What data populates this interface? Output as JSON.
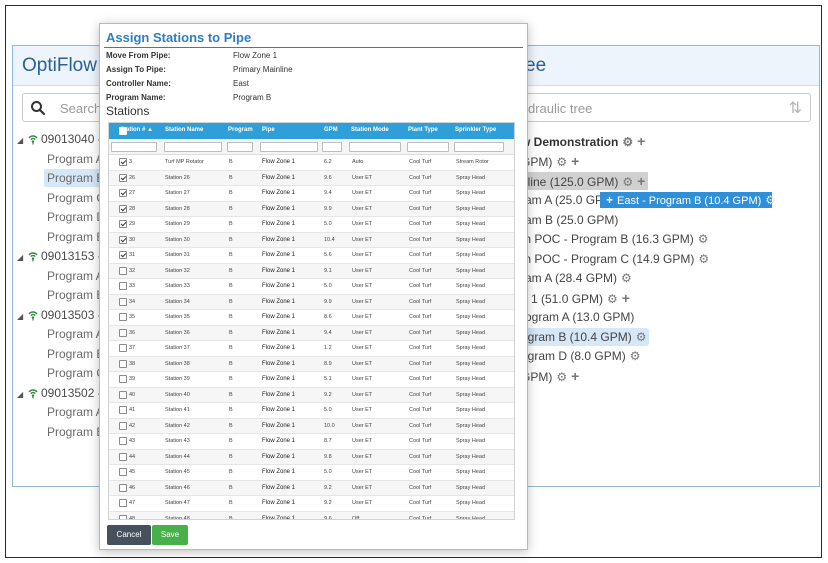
{
  "app": {
    "title_left": "OptiFlow C",
    "title_right": "ee",
    "search_placeholder": "Search",
    "tree_search_placeholder": "draulic tree"
  },
  "controllers": [
    {
      "id": "09013040 -",
      "programs": [
        "Program A",
        "Program B",
        "Program C",
        "Program D",
        "Program E"
      ]
    },
    {
      "id": "09013153 -",
      "programs": [
        "Program A",
        "Program B"
      ]
    },
    {
      "id": "09013503 -",
      "programs": [
        "Program A",
        "Program B",
        "Program C"
      ]
    },
    {
      "id": "09013502 -",
      "programs": [
        "Program A",
        "Program B"
      ]
    }
  ],
  "hydraulic_tree": [
    "w Demonstration",
    "GPM)",
    "nline (125.0 GPM)",
    "ram A (25.0 GP",
    "ram B (25.0 GPM)",
    "th POC - Program B (16.3 GPM)",
    "th POC - Program C (14.9 GPM)",
    "ram A (28.4 GPM)",
    "e 1 (51.0 GPM)",
    "rogram A (13.0 GPM)",
    "ogram B (10.4 GPM)",
    "ogram D (8.0 GPM)",
    "GPM)"
  ],
  "drag_tag": "East - Program B (10.4 GPM)",
  "modal": {
    "title": "Assign Stations to Pipe",
    "move_from_label": "Move From Pipe:",
    "move_from_value": "Flow Zone 1",
    "assign_to_label": "Assign To Pipe:",
    "assign_to_value": "Primary Mainline",
    "controller_label": "Controller Name:",
    "controller_value": "East",
    "program_label": "Program Name:",
    "program_value": "Program B",
    "stations_heading": "Stations",
    "cancel_label": "Cancel",
    "save_label": "Save",
    "columns": [
      "Station #",
      "Station Name",
      "Program",
      "Pipe",
      "GPM",
      "Station Mode",
      "Plant Type",
      "Sprinkler Type"
    ]
  },
  "stations": [
    {
      "checked": true,
      "num": "3",
      "name": "Turf MP Rotator",
      "program": "B",
      "pipe": "Flow Zone 1",
      "gpm": "6.2",
      "mode": "Auto",
      "plant": "Cool Turf",
      "sprinkler": "Stream Rotor"
    },
    {
      "checked": true,
      "num": "26",
      "name": "Station 26",
      "program": "B",
      "pipe": "Flow Zone 1",
      "gpm": "9.6",
      "mode": "User ET",
      "plant": "Cool Turf",
      "sprinkler": "Spray Head"
    },
    {
      "checked": true,
      "num": "27",
      "name": "Station 27",
      "program": "B",
      "pipe": "Flow Zone 1",
      "gpm": "9.4",
      "mode": "User ET",
      "plant": "Cool Turf",
      "sprinkler": "Spray Head"
    },
    {
      "checked": true,
      "num": "28",
      "name": "Station 28",
      "program": "B",
      "pipe": "Flow Zone 1",
      "gpm": "9.9",
      "mode": "User ET",
      "plant": "Cool Turf",
      "sprinkler": "Spray Head"
    },
    {
      "checked": true,
      "num": "29",
      "name": "Station 29",
      "program": "B",
      "pipe": "Flow Zone 1",
      "gpm": "5.0",
      "mode": "User ET",
      "plant": "Cool Turf",
      "sprinkler": "Spray Head"
    },
    {
      "checked": true,
      "num": "30",
      "name": "Station 30",
      "program": "B",
      "pipe": "Flow Zone 1",
      "gpm": "10.4",
      "mode": "User ET",
      "plant": "Cool Turf",
      "sprinkler": "Spray Head"
    },
    {
      "checked": true,
      "num": "31",
      "name": "Station 31",
      "program": "B",
      "pipe": "Flow Zone 1",
      "gpm": "5.6",
      "mode": "User ET",
      "plant": "Cool Turf",
      "sprinkler": "Spray Head"
    },
    {
      "checked": false,
      "num": "32",
      "name": "Station 32",
      "program": "B",
      "pipe": "Flow Zone 1",
      "gpm": "9.1",
      "mode": "User ET",
      "plant": "Cool Turf",
      "sprinkler": "Spray Head"
    },
    {
      "checked": false,
      "num": "33",
      "name": "Station 33",
      "program": "B",
      "pipe": "Flow Zone 1",
      "gpm": "5.0",
      "mode": "User ET",
      "plant": "Cool Turf",
      "sprinkler": "Spray Head"
    },
    {
      "checked": false,
      "num": "34",
      "name": "Station 34",
      "program": "B",
      "pipe": "Flow Zone 1",
      "gpm": "9.9",
      "mode": "User ET",
      "plant": "Cool Turf",
      "sprinkler": "Spray Head"
    },
    {
      "checked": false,
      "num": "35",
      "name": "Station 35",
      "program": "B",
      "pipe": "Flow Zone 1",
      "gpm": "8.6",
      "mode": "User ET",
      "plant": "Cool Turf",
      "sprinkler": "Spray Head"
    },
    {
      "checked": false,
      "num": "36",
      "name": "Station 36",
      "program": "B",
      "pipe": "Flow Zone 1",
      "gpm": "9.4",
      "mode": "User ET",
      "plant": "Cool Turf",
      "sprinkler": "Spray Head"
    },
    {
      "checked": false,
      "num": "37",
      "name": "Station 37",
      "program": "B",
      "pipe": "Flow Zone 1",
      "gpm": "1.2",
      "mode": "User ET",
      "plant": "Cool Turf",
      "sprinkler": "Spray Head"
    },
    {
      "checked": false,
      "num": "38",
      "name": "Station 38",
      "program": "B",
      "pipe": "Flow Zone 1",
      "gpm": "8.9",
      "mode": "User ET",
      "plant": "Cool Turf",
      "sprinkler": "Spray Head"
    },
    {
      "checked": false,
      "num": "39",
      "name": "Station 39",
      "program": "B",
      "pipe": "Flow Zone 1",
      "gpm": "5.1",
      "mode": "User ET",
      "plant": "Cool Turf",
      "sprinkler": "Spray Head"
    },
    {
      "checked": false,
      "num": "40",
      "name": "Station 40",
      "program": "B",
      "pipe": "Flow Zone 1",
      "gpm": "9.2",
      "mode": "User ET",
      "plant": "Cool Turf",
      "sprinkler": "Spray Head"
    },
    {
      "checked": false,
      "num": "41",
      "name": "Station 41",
      "program": "B",
      "pipe": "Flow Zone 1",
      "gpm": "5.0",
      "mode": "User ET",
      "plant": "Cool Turf",
      "sprinkler": "Spray Head"
    },
    {
      "checked": false,
      "num": "42",
      "name": "Station 42",
      "program": "B",
      "pipe": "Flow Zone 1",
      "gpm": "10.0",
      "mode": "User ET",
      "plant": "Cool Turf",
      "sprinkler": "Spray Head"
    },
    {
      "checked": false,
      "num": "43",
      "name": "Station 43",
      "program": "B",
      "pipe": "Flow Zone 1",
      "gpm": "8.7",
      "mode": "User ET",
      "plant": "Cool Turf",
      "sprinkler": "Spray Head"
    },
    {
      "checked": false,
      "num": "44",
      "name": "Station 44",
      "program": "B",
      "pipe": "Flow Zone 1",
      "gpm": "9.8",
      "mode": "User ET",
      "plant": "Cool Turf",
      "sprinkler": "Spray Head"
    },
    {
      "checked": false,
      "num": "45",
      "name": "Station 45",
      "program": "B",
      "pipe": "Flow Zone 1",
      "gpm": "5.0",
      "mode": "User ET",
      "plant": "Cool Turf",
      "sprinkler": "Spray Head"
    },
    {
      "checked": false,
      "num": "46",
      "name": "Station 46",
      "program": "B",
      "pipe": "Flow Zone 1",
      "gpm": "9.2",
      "mode": "User ET",
      "plant": "Cool Turf",
      "sprinkler": "Spray Head"
    },
    {
      "checked": false,
      "num": "47",
      "name": "Station 47",
      "program": "B",
      "pipe": "Flow Zone 1",
      "gpm": "9.2",
      "mode": "User ET",
      "plant": "Cool Turf",
      "sprinkler": "Spray Head"
    },
    {
      "checked": false,
      "num": "48",
      "name": "Station 48",
      "program": "B",
      "pipe": "Flow Zone 1",
      "gpm": "9.6",
      "mode": "Off",
      "plant": "Cool Turf",
      "sprinkler": "Spray Head"
    }
  ],
  "colors": {
    "accent": "#2f7ec2",
    "grid_header": "#2f9fd9",
    "save": "#47b04b",
    "cancel": "#45525e",
    "drag": "#2f8fd8"
  },
  "icons": {
    "search": "search-icon",
    "gear": "gear-icon",
    "plus": "plus-icon",
    "sort": "sort-arrows-icon",
    "controller": "wifi-controller-icon"
  }
}
